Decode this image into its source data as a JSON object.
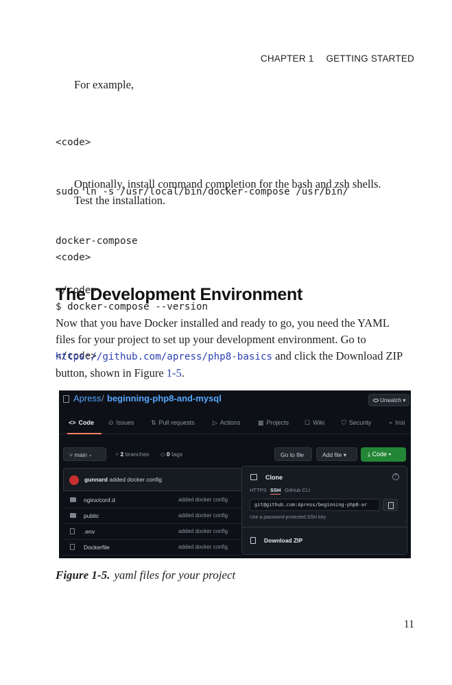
{
  "running_head": {
    "chapter": "CHAPTER 1",
    "title": "GETTING STARTED"
  },
  "para1": "For example,",
  "code1": [
    "<code>",
    "sudo ln -s /usr/local/bin/docker-compose /usr/bin/",
    "docker-compose",
    "</code>"
  ],
  "para2": [
    "Optionally, install command completion for the bash and zsh shells.",
    "Test the installation."
  ],
  "code2": [
    "<code>",
    "$ docker-compose --version",
    "</code>"
  ],
  "heading": "The Development Environment",
  "body": {
    "line1": "Now that you have Docker installed and ready to go, you need the YAML",
    "line2": "files for your project to set up your development environment. Go to",
    "link": "https://github.com/apress/php8-basics",
    "line3_after": " and click the Download ZIP",
    "line4_before": "button, shown in Figure ",
    "figure_ref": "1-5",
    "line4_after": "."
  },
  "screenshot": {
    "owner": "Apress",
    "slash": "/",
    "repo": "beginning-php8-and-mysql",
    "unwatch": "Unwatch",
    "tabs": [
      {
        "icon": "<>",
        "label": "Code"
      },
      {
        "icon": "⊙",
        "label": "Issues"
      },
      {
        "icon": "⇅",
        "label": "Pull requests"
      },
      {
        "icon": "▷",
        "label": "Actions"
      },
      {
        "icon": "▦",
        "label": "Projects"
      },
      {
        "icon": "☐",
        "label": "Wiki"
      },
      {
        "icon": "⛉",
        "label": "Security"
      },
      {
        "icon": "⌁",
        "label": "Insi"
      }
    ],
    "branch_button": "main",
    "branches_count": "2",
    "branches_label": "branches",
    "tags_count": "0",
    "tags_label": "tags",
    "go_to_file": "Go to file",
    "add_file": "Add file",
    "code_button": "Code",
    "commit_author": "gunnard",
    "commit_message": "added docker config",
    "files": [
      {
        "name": "nginx/conf.d",
        "type": "folder",
        "message": "added docker config"
      },
      {
        "name": "public",
        "type": "folder",
        "message": "added docker config"
      },
      {
        "name": ".env",
        "type": "file",
        "message": "added docker config"
      },
      {
        "name": "Dockerfile",
        "type": "file",
        "message": "added docker config"
      }
    ],
    "clone": {
      "title": "Clone",
      "protocols": [
        "HTTPS",
        "SSH",
        "GitHub CLI"
      ],
      "active_protocol": "SSH",
      "url": "git@github.com:Apress/beginning-php8-ar",
      "hint": "Use a password-protected SSH key.",
      "download_zip": "Download ZIP"
    }
  },
  "caption": {
    "label": "Figure 1-5.",
    "text": "yaml files for your project"
  },
  "page_number": "11",
  "colors": {
    "link": "#2a3fb0",
    "github_bg": "#0d1117",
    "github_green": "#238636",
    "github_blue": "#58a6ff"
  }
}
